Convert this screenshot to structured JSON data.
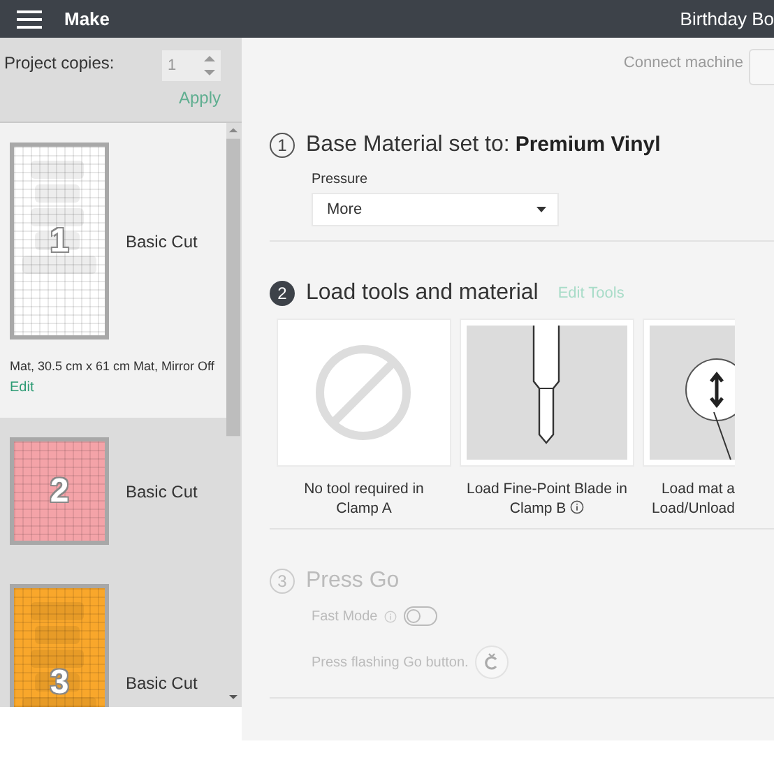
{
  "top_bar": {
    "title": "Make",
    "project_name": "Birthday Bo"
  },
  "sidebar": {
    "copies_label": "Project copies:",
    "copies_value": "1",
    "copies_disabled": true,
    "apply": "Apply",
    "apply_disabled": true,
    "mats": [
      {
        "number": "1",
        "label": "Basic Cut",
        "color": "#ffffff",
        "kind": "long",
        "selected": true,
        "details": "Mat, 30.5 cm x 61 cm Mat, Mirror Off",
        "edit": "Edit"
      },
      {
        "number": "2",
        "label": "Basic Cut",
        "color": "#f4a3a8",
        "kind": "square",
        "selected": false
      },
      {
        "number": "3",
        "label": "Basic Cut",
        "color": "#f9a72b",
        "kind": "long",
        "selected": false
      }
    ]
  },
  "machine": {
    "label": "Connect machine"
  },
  "steps": [
    {
      "number": "1",
      "current": false,
      "disabled": false,
      "kind": "material",
      "title": "Base Material set to:",
      "value": "Premium Vinyl",
      "pressure_label": "Pressure",
      "pressure": "More"
    },
    {
      "number": "2",
      "current": true,
      "disabled": false,
      "kind": "tools",
      "title": "Load tools and material",
      "link": "Edit Tools",
      "tools": [
        {
          "kind": "none",
          "caption": [
            "No tool required in",
            "Clamp A"
          ],
          "info": false
        },
        {
          "kind": "blade",
          "caption": [
            "Load Fine-Point Blade in",
            "Clamp B"
          ],
          "info": true
        },
        {
          "kind": "mat",
          "caption": [
            "Load mat a",
            "Load/Unload"
          ],
          "info": false
        }
      ]
    },
    {
      "number": "3",
      "current": false,
      "disabled": true,
      "kind": "go",
      "title": "Press Go",
      "fast_mode_label": "Fast Mode",
      "fast_mode_on": false,
      "go_text": "Press flashing Go button."
    }
  ]
}
